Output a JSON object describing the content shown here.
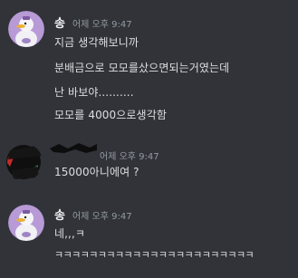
{
  "messages": [
    {
      "author": "송",
      "timestamp": "어제 오후 9:47",
      "avatar": "duck-avatar",
      "lines": [
        "지금 생각해보니까",
        "분배금으로 모모를샀으면되는거였는데",
        "난 바보야..........",
        "모모를 4000으로생각함"
      ]
    },
    {
      "author": "",
      "timestamp": "어제 오후 9:47",
      "avatar": "redacted-avatar",
      "lines": [
        "15000아니에여 ?"
      ]
    },
    {
      "author": "송",
      "timestamp": "어제 오후 9:47",
      "avatar": "duck-avatar",
      "lines": [
        "네,,,ㅋ",
        "ㅋㅋㅋㅋㅋㅋㅋㅋㅋㅋㅋㅋㅋㅋㅋㅋㅋㅋㅋㅋㅋㅋㅋ"
      ]
    }
  ],
  "colors": {
    "background": "#313338",
    "text": "#dbdee1",
    "author": "#f2f3f5",
    "timestamp": "#949ba4",
    "avatar_bg": "#b79ad6"
  }
}
